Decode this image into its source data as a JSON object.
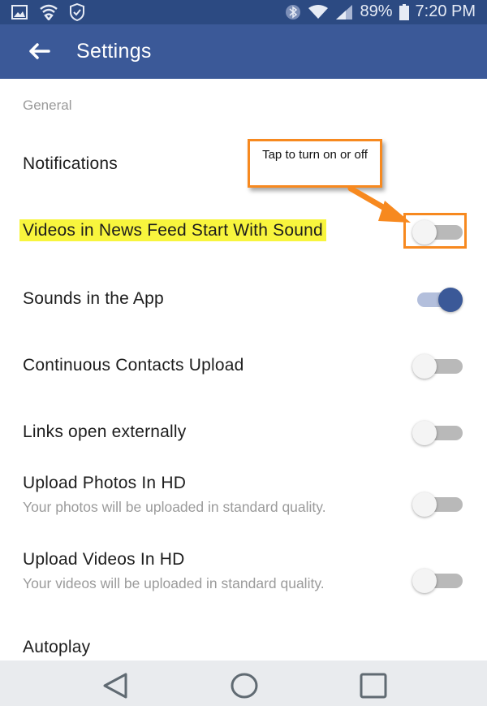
{
  "status_bar": {
    "icons_left": [
      "image-icon",
      "wifi-shield-icon",
      "security-shield-icon"
    ],
    "icons_right": [
      "bluetooth-icon",
      "wifi-icon",
      "signal-icon"
    ],
    "battery_percent": "89%",
    "time": "7:20 PM"
  },
  "app_bar": {
    "back_icon": "back-arrow-icon",
    "title": "Settings"
  },
  "section": {
    "header": "General"
  },
  "settings": [
    {
      "label": "Notifications",
      "has_toggle": false
    },
    {
      "label": "Videos in News Feed Start With Sound",
      "has_toggle": true,
      "enabled": false,
      "highlighted": true
    },
    {
      "label": "Sounds in the App",
      "has_toggle": true,
      "enabled": true
    },
    {
      "label": "Continuous Contacts Upload",
      "has_toggle": true,
      "enabled": false
    },
    {
      "label": "Links open externally",
      "has_toggle": true,
      "enabled": false
    },
    {
      "label": "Upload Photos In HD",
      "subtitle": "Your photos will be uploaded in standard quality.",
      "has_toggle": true,
      "enabled": false
    },
    {
      "label": "Upload Videos In HD",
      "subtitle": "Your videos will be uploaded in standard quality.",
      "has_toggle": true,
      "enabled": false
    },
    {
      "label": "Autoplay",
      "has_toggle": false
    }
  ],
  "annotation": {
    "callout_text": "Tap  to turn on or off",
    "accent_color": "#f7891f",
    "highlight_color": "#f8f53d"
  },
  "nav_bar": {
    "buttons": [
      "back-triangle-icon",
      "home-circle-icon",
      "recents-square-icon"
    ]
  },
  "colors": {
    "brand": "#3b5998",
    "status_bar": "#2c4a82"
  }
}
